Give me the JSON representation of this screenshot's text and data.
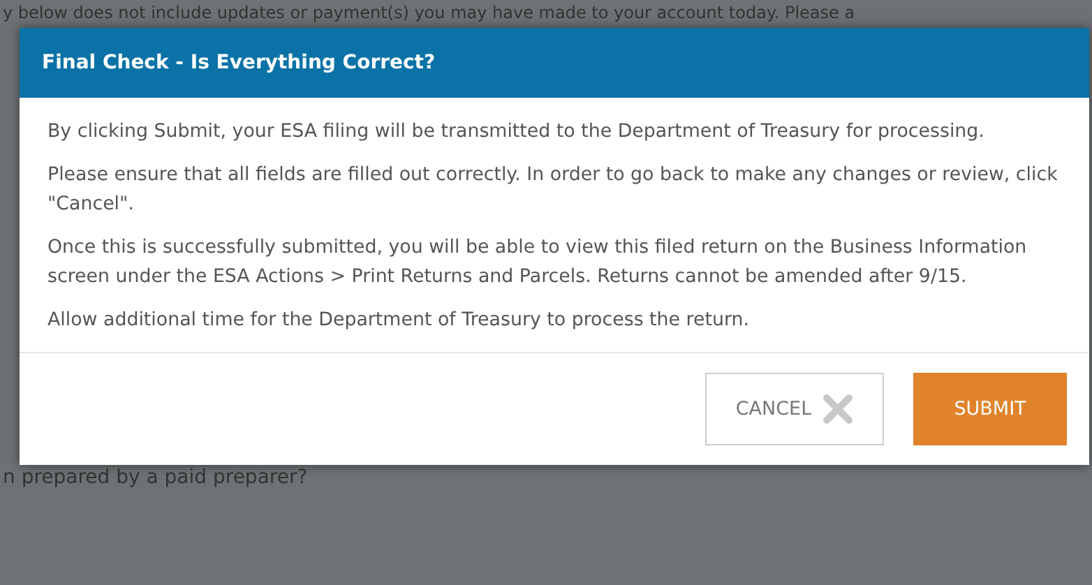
{
  "background": {
    "top_text": "y below does not include updates or payment(s) you may have made to your account today. Please a",
    "bottom_text": "n prepared by a paid preparer?"
  },
  "dialog": {
    "title": "Final Check - Is Everything Correct?",
    "paragraphs": [
      "By clicking Submit, your ESA filing will be transmitted to the Department of Treasury for processing.",
      "Please ensure that all fields are filled out correctly. In order to go back to make any changes or review, click \"Cancel\".",
      "Once this is successfully submitted, you will be able to view this filed return on the Business Information screen under the ESA Actions > Print Returns and Parcels. Returns cannot be amended after 9/15.",
      "Allow additional time for the Department of Treasury to process the return."
    ],
    "buttons": [
      {
        "kind": "cancel",
        "label": "CANCEL"
      },
      {
        "kind": "submit",
        "label": "SUBMIT"
      }
    ]
  }
}
